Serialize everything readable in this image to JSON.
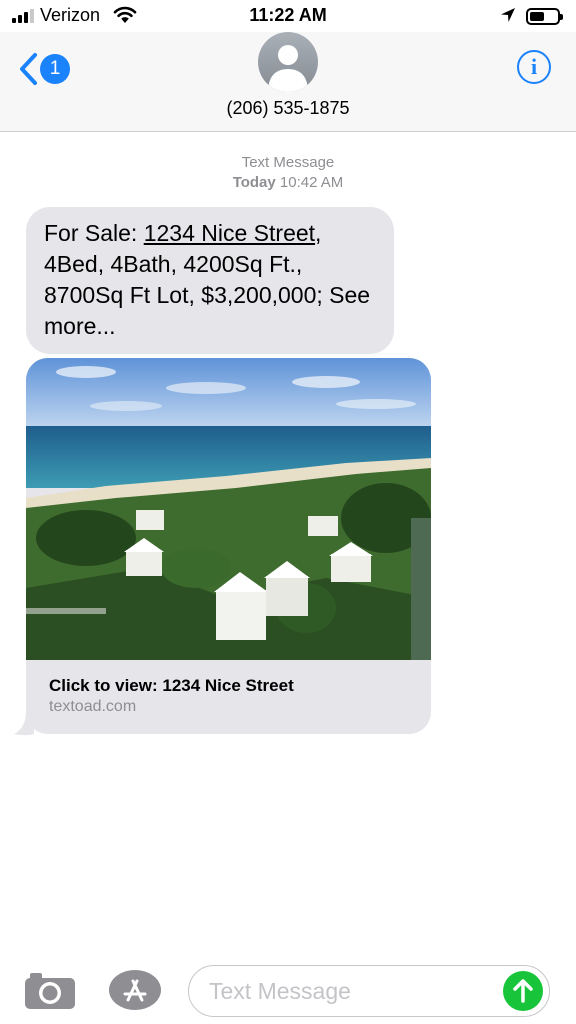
{
  "status_bar": {
    "carrier": "Verizon",
    "time": "11:22 AM"
  },
  "nav": {
    "back_badge": "1",
    "contact_number": "(206) 535-1875",
    "info_label": "i"
  },
  "thread": {
    "service": "Text Message",
    "day": "Today",
    "time": "10:42 AM",
    "message": {
      "prefix": "For Sale: ",
      "address": "1234 Nice Street",
      "rest": ", 4Bed, 4Bath, 4200Sq Ft., 8700Sq Ft Lot, $3,200,000; See more..."
    },
    "link_preview": {
      "title": "Click to view: 1234 Nice Street",
      "domain": "textoad.com"
    }
  },
  "composer": {
    "placeholder": "Text Message",
    "value": ""
  },
  "icons": {
    "back": "chevron-left-icon",
    "info": "info-icon",
    "avatar": "person-icon",
    "camera": "camera-icon",
    "appstore": "app-store-icon",
    "send": "arrow-up-icon"
  },
  "colors": {
    "accent": "#1a82fb",
    "bubble": "#e5e5ea",
    "send": "#18c43a",
    "meta": "#8e8e93"
  }
}
